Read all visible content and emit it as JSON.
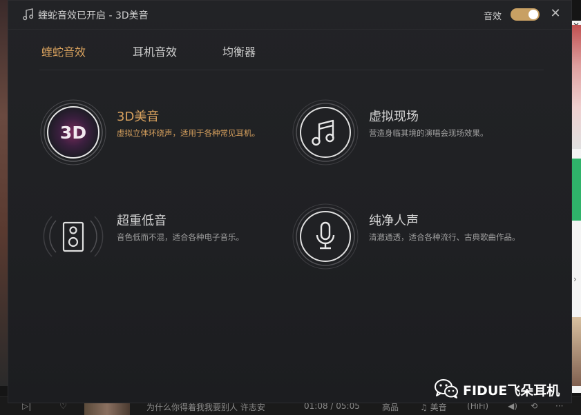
{
  "window": {
    "title": "蝰蛇音效已开启 - 3D美音",
    "toggle_label": "音效",
    "toggle_on": true,
    "close_icon": "close-icon"
  },
  "tabs": [
    {
      "label": "蝰蛇音效",
      "active": true
    },
    {
      "label": "耳机音效",
      "active": false
    },
    {
      "label": "均衡器",
      "active": false
    }
  ],
  "effects": [
    {
      "name": "3D美音",
      "desc": "虚拟立体环绕声，适用于各种常见耳机。",
      "icon": "3d-icon",
      "icon_text": "3D",
      "active": true
    },
    {
      "name": "虚拟现场",
      "desc": "营造身临其境的演唱会现场效果。",
      "icon": "music-note-icon",
      "active": false
    },
    {
      "name": "超重低音",
      "desc": "音色低而不混，适合各种电子音乐。",
      "icon": "speaker-icon",
      "active": false
    },
    {
      "name": "纯净人声",
      "desc": "清澈通透，适合各种流行、古典歌曲作品。",
      "icon": "microphone-icon",
      "active": false
    }
  ],
  "bottom_bar": {
    "song_partial": "为什么你得着我我要别人  许志安",
    "time": "01:08 / 05:05",
    "quality": "高品",
    "effect_label": "美音",
    "hifi": "HiFi"
  },
  "watermark": {
    "text": "FIDUE飞朵耳机",
    "icon": "wechat-icon"
  },
  "colors": {
    "accent": "#d9a25e",
    "toggle": "#c8a063",
    "background": "#1f2023"
  }
}
